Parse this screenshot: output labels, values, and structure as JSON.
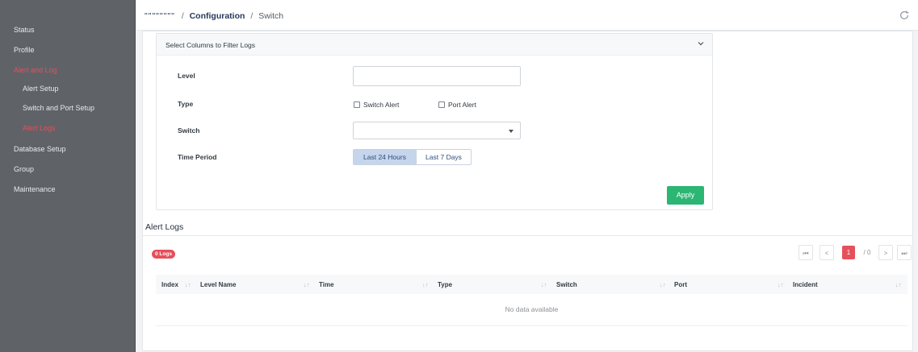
{
  "sidebar": {
    "items": [
      {
        "label": "Status"
      },
      {
        "label": "Profile"
      },
      {
        "label": "Alert and Log"
      },
      {
        "label": "Alert Setup"
      },
      {
        "label": "Switch and Port Setup"
      },
      {
        "label": "Alert Logs"
      },
      {
        "label": "Database Setup"
      },
      {
        "label": "Group"
      },
      {
        "label": "Maintenance"
      }
    ]
  },
  "breadcrumb": {
    "hidden_text": "\"\"\"\"\"\"\"\" ",
    "sep1": "/",
    "section": "Configuration",
    "sep2": "/",
    "page": "Switch"
  },
  "filter": {
    "title": "Select Columns to Filter Logs",
    "level_label": "Level",
    "level_value": "",
    "type_label": "Type",
    "type_options": [
      "Switch Alert",
      "Port Alert"
    ],
    "switch_label": "Switch",
    "switch_value": "",
    "time_label": "Time Period",
    "time_options": [
      "Last 24 Hours",
      "Last 7 Days"
    ],
    "apply_label": "Apply"
  },
  "logs": {
    "title": "Alert Logs",
    "count_badge": "0 Logs",
    "pager": {
      "first": "⏮",
      "prev": "<",
      "current": "1",
      "total": "/ 0",
      "next": ">",
      "last": "⏭"
    },
    "columns": [
      "Index",
      "Level Name",
      "Time",
      "Type",
      "Switch",
      "Port",
      "Incident"
    ],
    "empty_text": "No data available"
  },
  "colors": {
    "accent": "#e5505b",
    "apply": "#2bb673",
    "sidebar_bg": "#5f6368",
    "navy": "#263b5a"
  },
  "icons": [
    "refresh-icon",
    "chevron-down-icon",
    "sort-icon",
    "checkbox-icon",
    "dropdown-caret-icon"
  ]
}
